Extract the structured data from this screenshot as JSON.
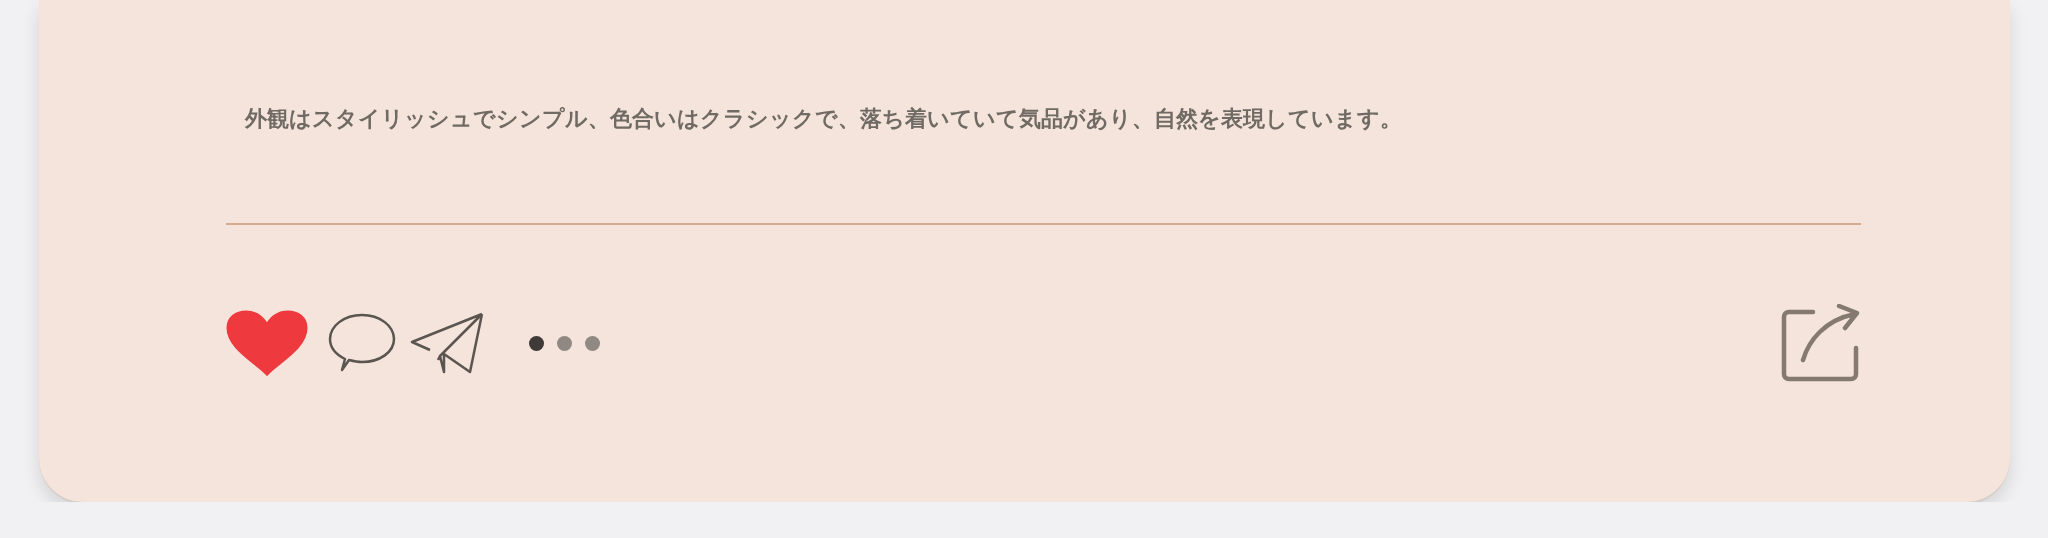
{
  "post": {
    "caption": "外観はスタイリッシュでシンプル、色合いはクラシックで、落ち着いていて気品があり、自然を表現しています。",
    "actions": {
      "liked": true
    },
    "carousel_dots": [
      {
        "selected": true
      },
      {
        "selected": false
      },
      {
        "selected": false
      }
    ]
  }
}
